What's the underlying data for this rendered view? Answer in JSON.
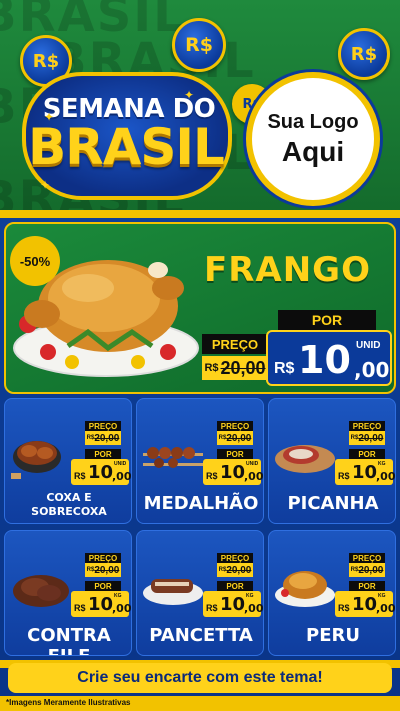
{
  "header": {
    "bg_word": "BRASIL",
    "coin_symbol": "R$",
    "emblem_top": "SEMANA DO",
    "emblem_main": "BRASIL",
    "logo_line1": "Sua Logo",
    "logo_line2": "Aqui"
  },
  "featured": {
    "discount": "-50%",
    "name": "FRANGO",
    "preco_label": "PREÇO",
    "old_currency": "R$",
    "old_price": "20,00",
    "por_label": "POR",
    "currency": "R$",
    "price_int": "10",
    "price_dec": ",00",
    "unit": "UNID"
  },
  "labels": {
    "preco": "PREÇO",
    "por": "POR",
    "currency": "R$",
    "old_price": "20,00"
  },
  "products": [
    {
      "name": "COXA E SOBRECOXA",
      "price_int": "10",
      "price_dec": ",00",
      "unit": "UNID"
    },
    {
      "name": "MEDALHÃO",
      "price_int": "10",
      "price_dec": ",00",
      "unit": "UNID"
    },
    {
      "name": "PICANHA",
      "price_int": "10",
      "price_dec": ",00",
      "unit": "KG"
    },
    {
      "name": "CONTRA FILE",
      "price_int": "10",
      "price_dec": ",00",
      "unit": "KG"
    },
    {
      "name": "PANCETTA",
      "price_int": "10",
      "price_dec": ",00",
      "unit": "KG"
    },
    {
      "name": "PERU",
      "price_int": "10",
      "price_dec": ",00",
      "unit": "KG"
    }
  ],
  "cta": "Crie seu encarte com este tema!",
  "footnote": "*Imagens Meramente Ilustrativas",
  "colors": {
    "green": "#1f8a3d",
    "blue": "#0b3a9a",
    "yellow": "#f2c200"
  }
}
